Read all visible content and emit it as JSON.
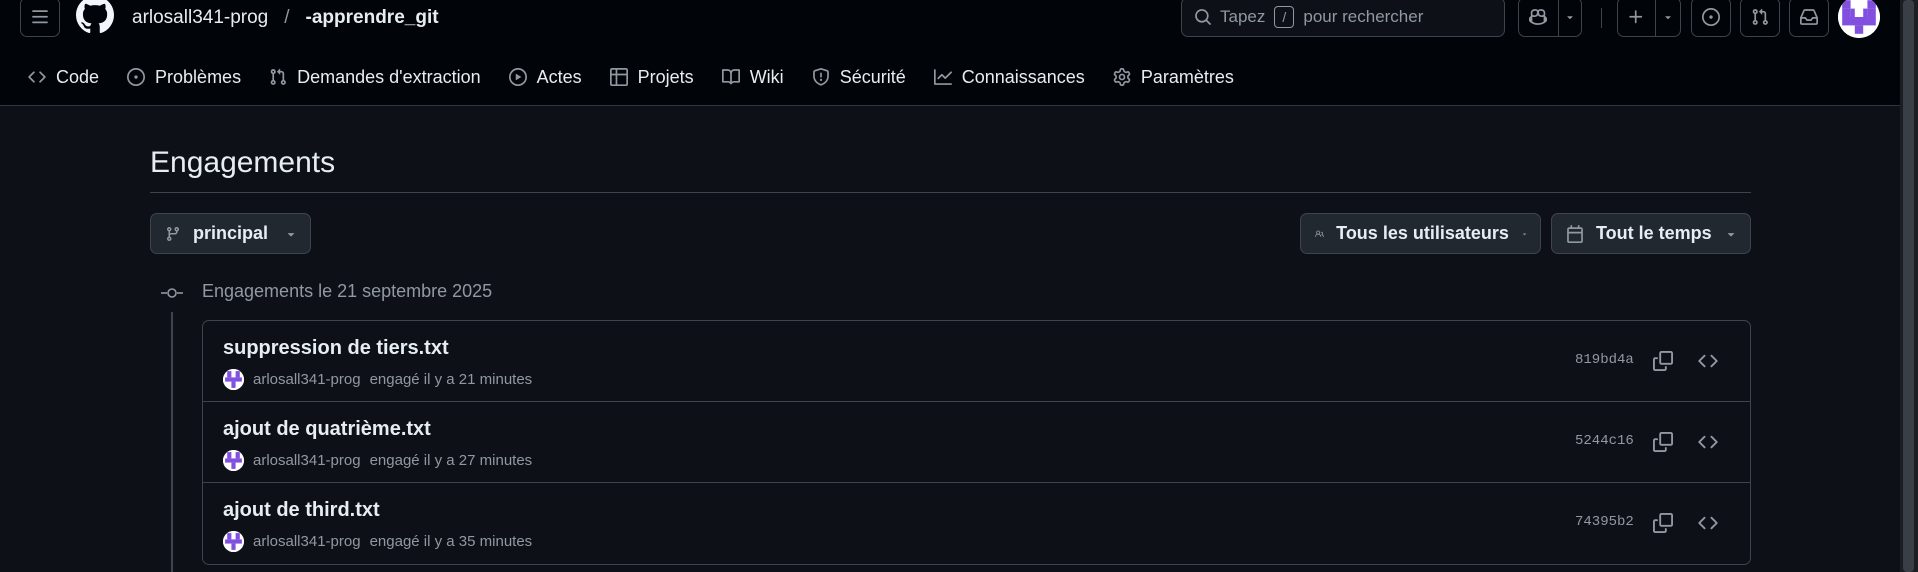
{
  "header": {
    "owner": "arlosall341-prog",
    "separator": "/",
    "repo": "-apprendre_git",
    "search": {
      "before": "Tapez",
      "key": "/",
      "after": "pour rechercher"
    }
  },
  "repo_nav": [
    {
      "label": "Code",
      "icon": "code-icon"
    },
    {
      "label": "Problèmes",
      "icon": "issue-icon"
    },
    {
      "label": "Demandes d'extraction",
      "icon": "pull-request-icon"
    },
    {
      "label": "Actes",
      "icon": "play-icon"
    },
    {
      "label": "Projets",
      "icon": "table-icon"
    },
    {
      "label": "Wiki",
      "icon": "book-icon"
    },
    {
      "label": "Sécurité",
      "icon": "shield-icon"
    },
    {
      "label": "Connaissances",
      "icon": "graph-icon"
    },
    {
      "label": "Paramètres",
      "icon": "gear-icon"
    }
  ],
  "page": {
    "title": "Engagements",
    "branch": "principal",
    "users_filter": "Tous les utilisateurs",
    "time_filter": "Tout le temps",
    "group_heading": "Engagements le 21 septembre 2025"
  },
  "commits": [
    {
      "title": "suppression de tiers.txt",
      "author": "arlosall341-prog",
      "meta": "engagé il y a 21 minutes",
      "sha": "819bd4a"
    },
    {
      "title": "ajout de quatrième.txt",
      "author": "arlosall341-prog",
      "meta": "engagé il y a 27 minutes",
      "sha": "5244c16"
    },
    {
      "title": "ajout de third.txt",
      "author": "arlosall341-prog",
      "meta": "engagé il y a 35 minutes",
      "sha": "74395b2"
    }
  ],
  "colors": {
    "background": "#0d1117",
    "header_background": "#010409",
    "border": "#3d444d",
    "text": "#e6edf3",
    "muted": "#9198a1",
    "avatar_accent": "#8250df"
  }
}
